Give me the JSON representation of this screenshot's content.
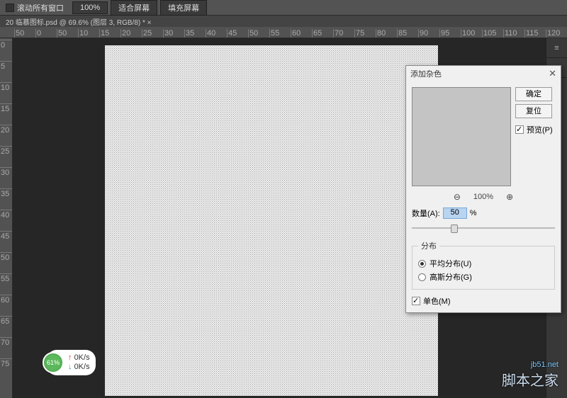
{
  "toolbar": {
    "scroll_all": "滚动所有窗口",
    "zoom": "100%",
    "fit_screen": "适合屏幕",
    "fill_screen": "填充屏幕"
  },
  "tab": {
    "label": "20 临慕图标.psd @ 69.6% (图层 3, RGB/8) * ×"
  },
  "ruler_h": [
    "50",
    "0",
    "50",
    "10",
    "15",
    "20",
    "25",
    "30",
    "35",
    "40",
    "45",
    "50",
    "55",
    "60",
    "65",
    "70",
    "75",
    "80",
    "85",
    "90",
    "95",
    "100",
    "105",
    "110",
    "115",
    "120"
  ],
  "ruler_v": [
    "0",
    "5",
    "10",
    "15",
    "20",
    "25",
    "30",
    "35",
    "40",
    "45",
    "50",
    "55",
    "60",
    "65",
    "70",
    "75"
  ],
  "right_rail": [
    "≡",
    "▶"
  ],
  "net": {
    "pct": "61%",
    "up": "0K/s",
    "down": "0K/s"
  },
  "watermark": {
    "url": "jb51.net",
    "cn": "脚本之家"
  },
  "dialog": {
    "title": "添加杂色",
    "ok": "确定",
    "reset": "复位",
    "preview": "预览(P)",
    "zoom_label": "100%",
    "amount_label": "数量(A):",
    "amount_value": "50",
    "amount_unit": "%",
    "dist_legend": "分布",
    "dist_uniform": "平均分布(U)",
    "dist_gauss": "高斯分布(G)",
    "mono": "单色(M)"
  }
}
